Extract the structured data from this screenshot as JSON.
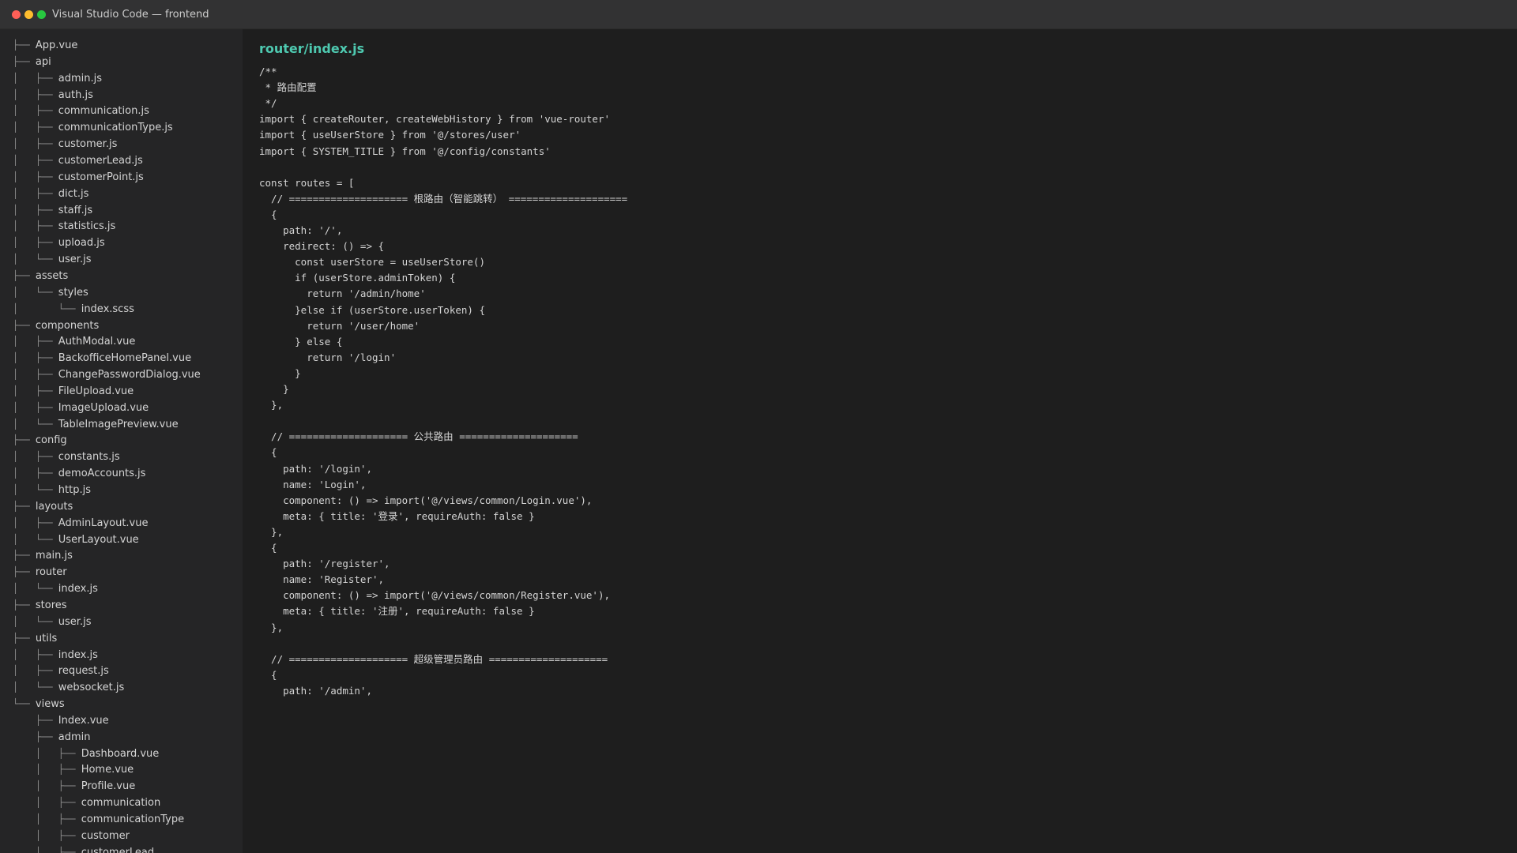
{
  "window": {
    "title": "Visual Studio Code — frontend"
  },
  "colors": {
    "titlebar_bg": "#323233",
    "sidebar_bg": "#252526",
    "editor_bg": "#1e1e1e",
    "file_heading": "#4ec9b0",
    "text": "#d4d4d4"
  },
  "icons": [
    "close-dot",
    "minimize-dot",
    "maximize-dot"
  ],
  "explorer": {
    "rows": [
      {
        "prefix": "├── ",
        "name": "App.vue"
      },
      {
        "prefix": "├── ",
        "name": "api"
      },
      {
        "prefix": "│   ├── ",
        "name": "admin.js"
      },
      {
        "prefix": "│   ├── ",
        "name": "auth.js"
      },
      {
        "prefix": "│   ├── ",
        "name": "communication.js"
      },
      {
        "prefix": "│   ├── ",
        "name": "communicationType.js"
      },
      {
        "prefix": "│   ├── ",
        "name": "customer.js"
      },
      {
        "prefix": "│   ├── ",
        "name": "customerLead.js"
      },
      {
        "prefix": "│   ├── ",
        "name": "customerPoint.js"
      },
      {
        "prefix": "│   ├── ",
        "name": "dict.js"
      },
      {
        "prefix": "│   ├── ",
        "name": "staff.js"
      },
      {
        "prefix": "│   ├── ",
        "name": "statistics.js"
      },
      {
        "prefix": "│   ├── ",
        "name": "upload.js"
      },
      {
        "prefix": "│   └── ",
        "name": "user.js"
      },
      {
        "prefix": "├── ",
        "name": "assets"
      },
      {
        "prefix": "│   └── ",
        "name": "styles"
      },
      {
        "prefix": "│       └── ",
        "name": "index.scss"
      },
      {
        "prefix": "├── ",
        "name": "components"
      },
      {
        "prefix": "│   ├── ",
        "name": "AuthModal.vue"
      },
      {
        "prefix": "│   ├── ",
        "name": "BackofficeHomePanel.vue"
      },
      {
        "prefix": "│   ├── ",
        "name": "ChangePasswordDialog.vue"
      },
      {
        "prefix": "│   ├── ",
        "name": "FileUpload.vue"
      },
      {
        "prefix": "│   ├── ",
        "name": "ImageUpload.vue"
      },
      {
        "prefix": "│   └── ",
        "name": "TableImagePreview.vue"
      },
      {
        "prefix": "├── ",
        "name": "config"
      },
      {
        "prefix": "│   ├── ",
        "name": "constants.js"
      },
      {
        "prefix": "│   ├── ",
        "name": "demoAccounts.js"
      },
      {
        "prefix": "│   └── ",
        "name": "http.js"
      },
      {
        "prefix": "├── ",
        "name": "layouts"
      },
      {
        "prefix": "│   ├── ",
        "name": "AdminLayout.vue"
      },
      {
        "prefix": "│   └── ",
        "name": "UserLayout.vue"
      },
      {
        "prefix": "├── ",
        "name": "main.js"
      },
      {
        "prefix": "├── ",
        "name": "router"
      },
      {
        "prefix": "│   └── ",
        "name": "index.js"
      },
      {
        "prefix": "├── ",
        "name": "stores"
      },
      {
        "prefix": "│   └── ",
        "name": "user.js"
      },
      {
        "prefix": "├── ",
        "name": "utils"
      },
      {
        "prefix": "│   ├── ",
        "name": "index.js"
      },
      {
        "prefix": "│   ├── ",
        "name": "request.js"
      },
      {
        "prefix": "│   └── ",
        "name": "websocket.js"
      },
      {
        "prefix": "└── ",
        "name": "views"
      },
      {
        "prefix": "    ├── ",
        "name": "Index.vue"
      },
      {
        "prefix": "    ├── ",
        "name": "admin"
      },
      {
        "prefix": "    │   ├── ",
        "name": "Dashboard.vue"
      },
      {
        "prefix": "    │   ├── ",
        "name": "Home.vue"
      },
      {
        "prefix": "    │   ├── ",
        "name": "Profile.vue"
      },
      {
        "prefix": "    │   ├── ",
        "name": "communication"
      },
      {
        "prefix": "    │   ├── ",
        "name": "communicationType"
      },
      {
        "prefix": "    │   ├── ",
        "name": "customer"
      },
      {
        "prefix": "    │   ├── ",
        "name": "customerLead"
      }
    ]
  },
  "editor": {
    "file_heading": "router/index.js",
    "lines": [
      "/**",
      " * 路由配置",
      " */",
      "import { createRouter, createWebHistory } from 'vue-router'",
      "import { useUserStore } from '@/stores/user'",
      "import { SYSTEM_TITLE } from '@/config/constants'",
      "",
      "const routes = [",
      "  // ==================== 根路由（智能跳转） ====================",
      "  {",
      "    path: '/',",
      "    redirect: () => {",
      "      const userStore = useUserStore()",
      "      if (userStore.adminToken) {",
      "        return '/admin/home'",
      "      }else if (userStore.userToken) {",
      "        return '/user/home'",
      "      } else {",
      "        return '/login'",
      "      }",
      "    }",
      "  },",
      "",
      "  // ==================== 公共路由 ====================",
      "  {",
      "    path: '/login',",
      "    name: 'Login',",
      "    component: () => import('@/views/common/Login.vue'),",
      "    meta: { title: '登录', requireAuth: false }",
      "  },",
      "  {",
      "    path: '/register',",
      "    name: 'Register',",
      "    component: () => import('@/views/common/Register.vue'),",
      "    meta: { title: '注册', requireAuth: false }",
      "  },",
      "",
      "  // ==================== 超级管理员路由 ====================",
      "  {",
      "    path: '/admin',"
    ]
  }
}
